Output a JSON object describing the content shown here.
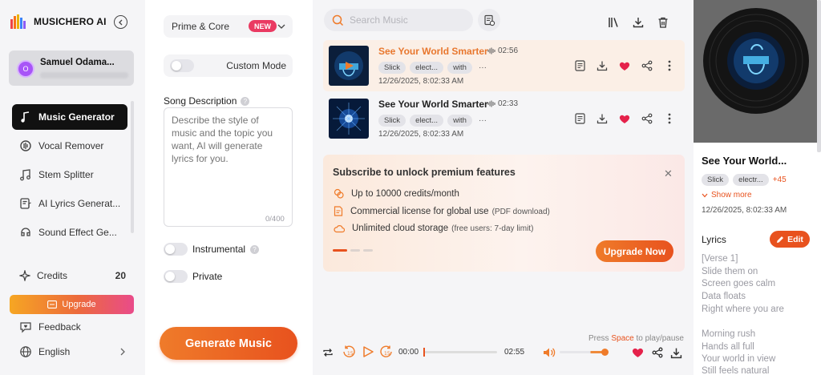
{
  "app": {
    "title": "MUSICHERO AI"
  },
  "sidebar": {
    "user_name": "Samuel Odama...",
    "avatar_letter": "O",
    "items": [
      {
        "label": "Music Generator",
        "icon": "music-note-icon",
        "active": true
      },
      {
        "label": "Vocal Remover",
        "icon": "vocal-remover-icon"
      },
      {
        "label": "Stem Splitter",
        "icon": "stem-splitter-icon"
      },
      {
        "label": "AI Lyrics Generat...",
        "icon": "lyrics-icon"
      },
      {
        "label": "Sound Effect Ge...",
        "icon": "sound-effect-icon"
      }
    ],
    "credits_label": "Credits",
    "credits_value": "20",
    "upgrade_label": "Upgrade",
    "feedback_label": "Feedback",
    "language_label": "English"
  },
  "settings": {
    "model_select": "Prime & Core",
    "new_badge": "NEW",
    "custom_mode_label": "Custom Mode",
    "song_description_label": "Song Description",
    "description_placeholder": "Describe the style of music and the topic you want, AI will generate lyrics for you.",
    "char_counter": "0/400",
    "instrumental_label": "Instrumental",
    "private_label": "Private",
    "generate_label": "Generate Music"
  },
  "main": {
    "search_placeholder": "Search Music",
    "songs": [
      {
        "title": "See Your World Smarter",
        "duration": "02:56",
        "tags": [
          "Slick",
          "elect...",
          "with"
        ],
        "more": "···",
        "date": "12/26/2025, 8:02:33 AM",
        "selected": true,
        "liked": true
      },
      {
        "title": "See Your World Smarter",
        "duration": "02:33",
        "tags": [
          "Slick",
          "elect...",
          "with"
        ],
        "more": "···",
        "date": "12/26/2025, 8:02:33 AM",
        "selected": false,
        "liked": true
      }
    ],
    "promo": {
      "title": "Subscribe to unlock premium features",
      "perks": [
        {
          "text": "Up to 10000 credits/month",
          "note": ""
        },
        {
          "text": "Commercial license for global use",
          "note": "(PDF download)"
        },
        {
          "text": "Unlimited cloud storage",
          "note": "(free users: 7-day limit)"
        }
      ],
      "cta": "Upgrade Now"
    }
  },
  "player": {
    "hint_prefix": "Press ",
    "hint_key": "Space",
    "hint_suffix": " to play/pause",
    "current_time": "00:00",
    "total_time": "02:55",
    "progress": 0,
    "volume": 0.3
  },
  "detail": {
    "title": "See Your World...",
    "tags": [
      "Slick",
      "electr..."
    ],
    "tags_more": "+45",
    "show_more": "Show more",
    "date": "12/26/2025, 8:02:33 AM",
    "lyrics_label": "Lyrics",
    "edit_label": "Edit",
    "lyrics": [
      "[Verse 1]",
      "Slide them on",
      "Screen goes calm",
      "Data floats",
      "Right where you are",
      "",
      "Morning rush",
      "Hands all full",
      "Your world in view",
      "Still feels natural"
    ]
  },
  "colors": {
    "accent": "#e8521e",
    "heart": "#e5224b",
    "active_nav": "#111111"
  }
}
